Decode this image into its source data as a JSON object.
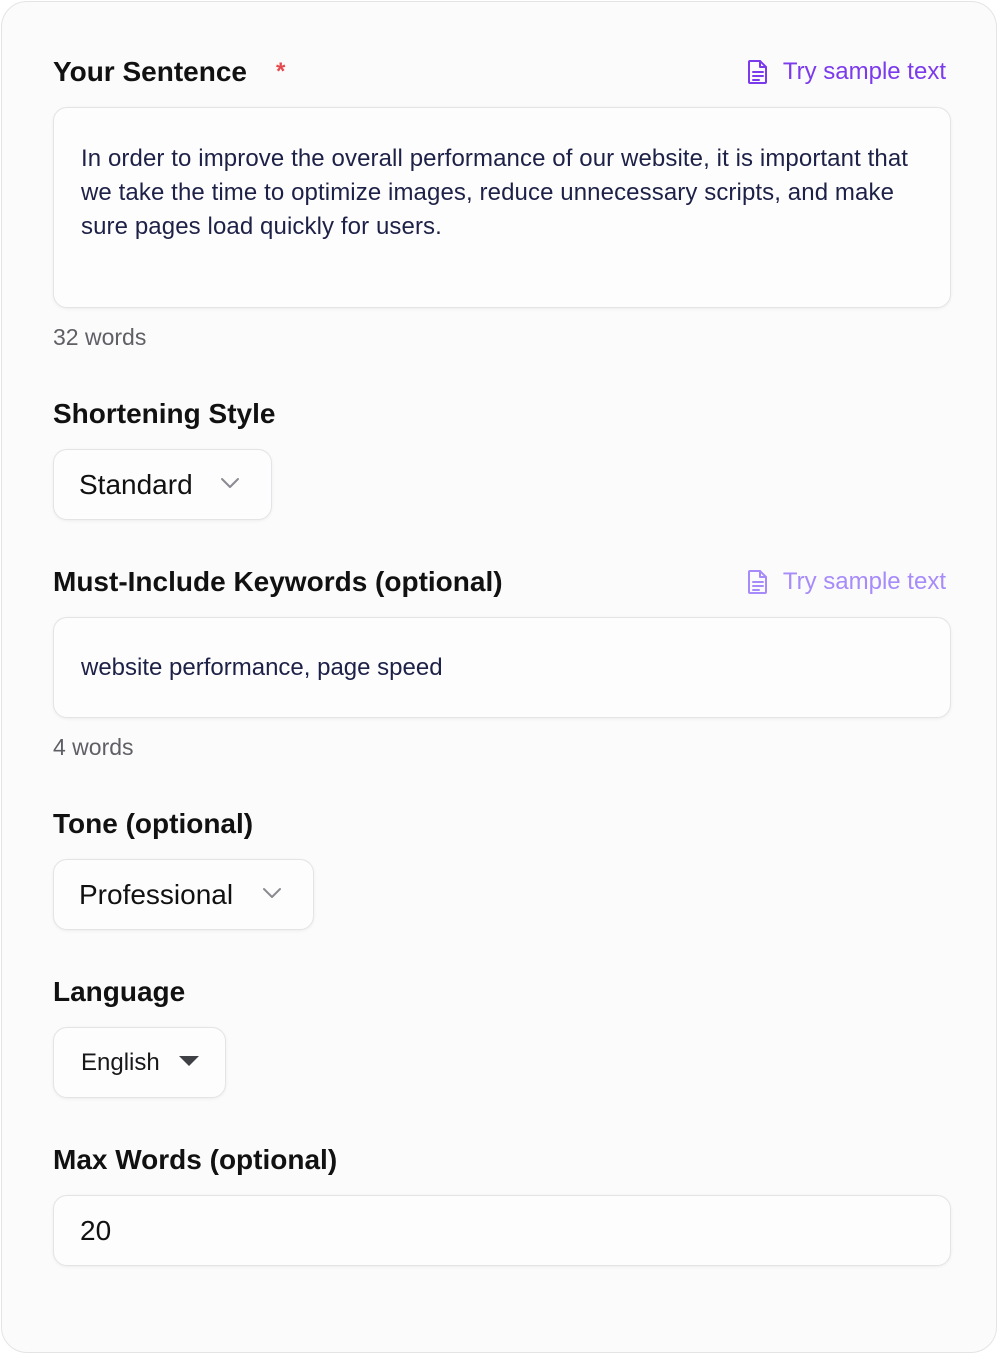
{
  "sentence": {
    "label": "Your Sentence",
    "required_mark": "*",
    "sample_link": "Try sample text",
    "value": "In order to improve the overall performance of our website, it is important that we take the time to optimize images, reduce unnecessary scripts, and make sure pages load quickly for users.",
    "word_count": "32 words"
  },
  "style": {
    "label": "Shortening Style",
    "selected": "Standard"
  },
  "keywords": {
    "label": "Must-Include Keywords (optional)",
    "sample_link": "Try sample text",
    "value": "website performance, page speed",
    "word_count": "4 words"
  },
  "tone": {
    "label": "Tone (optional)",
    "selected": "Professional"
  },
  "language": {
    "label": "Language",
    "selected": "English"
  },
  "max_words": {
    "label": "Max Words (optional)",
    "value": "20"
  },
  "icons": {
    "sample": "document-icon",
    "chevron": "chevron-down-icon",
    "caret": "caret-down-icon"
  },
  "colors": {
    "accent": "#7c3aed",
    "accent_faded": "#a78bfa",
    "required": "#e5484d",
    "text": "#111111",
    "muted": "#5f5f66",
    "border": "#e4e4e7"
  }
}
